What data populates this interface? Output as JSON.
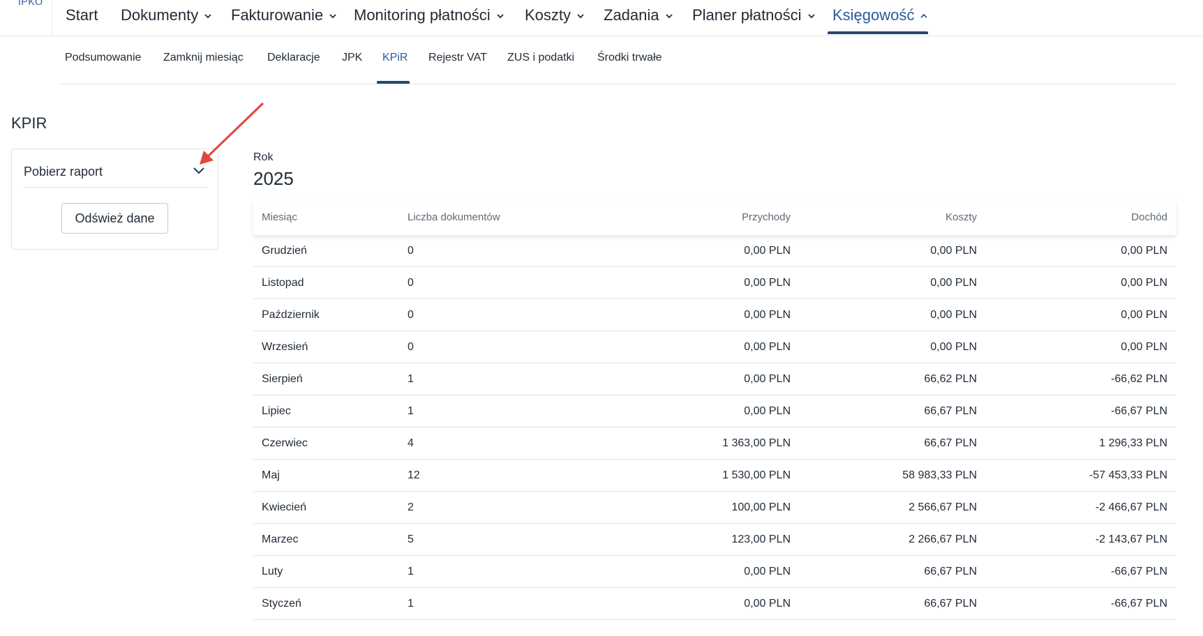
{
  "app": {
    "logo_text": "IPKO"
  },
  "nav": {
    "items": [
      {
        "label": "Start"
      },
      {
        "label": "Dokumenty"
      },
      {
        "label": "Fakturowanie"
      },
      {
        "label": "Monitoring płatności"
      },
      {
        "label": "Koszty"
      },
      {
        "label": "Zadania"
      },
      {
        "label": "Planer płatności"
      },
      {
        "label": "Księgowość"
      }
    ],
    "active": "Księgowość"
  },
  "subnav": {
    "items": [
      {
        "label": "Podsumowanie"
      },
      {
        "label": "Zamknij miesiąc"
      },
      {
        "label": "Deklaracje"
      },
      {
        "label": "JPK"
      },
      {
        "label": "KPiR"
      },
      {
        "label": "Rejestr VAT"
      },
      {
        "label": "ZUS i podatki"
      },
      {
        "label": "Środki trwałe"
      }
    ],
    "active": "KPiR"
  },
  "page": {
    "title": "KPIR",
    "report_select_label": "Pobierz raport",
    "refresh_button": "Odśwież dane",
    "year_label": "Rok",
    "year_value": "2025"
  },
  "table": {
    "headers": {
      "month": "Miesiąc",
      "docs": "Liczba dokumentów",
      "revenue": "Przychody",
      "costs": "Koszty",
      "income": "Dochód"
    },
    "rows": [
      {
        "month": "Grudzień",
        "docs": "0",
        "revenue": "0,00 PLN",
        "costs": "0,00 PLN",
        "income": "0,00 PLN"
      },
      {
        "month": "Listopad",
        "docs": "0",
        "revenue": "0,00 PLN",
        "costs": "0,00 PLN",
        "income": "0,00 PLN"
      },
      {
        "month": "Październik",
        "docs": "0",
        "revenue": "0,00 PLN",
        "costs": "0,00 PLN",
        "income": "0,00 PLN"
      },
      {
        "month": "Wrzesień",
        "docs": "0",
        "revenue": "0,00 PLN",
        "costs": "0,00 PLN",
        "income": "0,00 PLN"
      },
      {
        "month": "Sierpień",
        "docs": "1",
        "revenue": "0,00 PLN",
        "costs": "66,62 PLN",
        "income": "-66,62 PLN"
      },
      {
        "month": "Lipiec",
        "docs": "1",
        "revenue": "0,00 PLN",
        "costs": "66,67 PLN",
        "income": "-66,67 PLN"
      },
      {
        "month": "Czerwiec",
        "docs": "4",
        "revenue": "1 363,00 PLN",
        "costs": "66,67 PLN",
        "income": "1 296,33 PLN"
      },
      {
        "month": "Maj",
        "docs": "12",
        "revenue": "1 530,00 PLN",
        "costs": "58 983,33 PLN",
        "income": "-57 453,33 PLN"
      },
      {
        "month": "Kwiecień",
        "docs": "2",
        "revenue": "100,00 PLN",
        "costs": "2 566,67 PLN",
        "income": "-2 466,67 PLN"
      },
      {
        "month": "Marzec",
        "docs": "5",
        "revenue": "123,00 PLN",
        "costs": "2 266,67 PLN",
        "income": "-2 143,67 PLN"
      },
      {
        "month": "Luty",
        "docs": "1",
        "revenue": "0,00 PLN",
        "costs": "66,67 PLN",
        "income": "-66,67 PLN"
      },
      {
        "month": "Styczeń",
        "docs": "1",
        "revenue": "0,00 PLN",
        "costs": "66,67 PLN",
        "income": "-66,67 PLN"
      }
    ]
  },
  "colors": {
    "accent": "#26466b",
    "active_text": "#2a5a9c",
    "annotation_arrow": "#e0463b",
    "border": "#dfe3e8"
  }
}
